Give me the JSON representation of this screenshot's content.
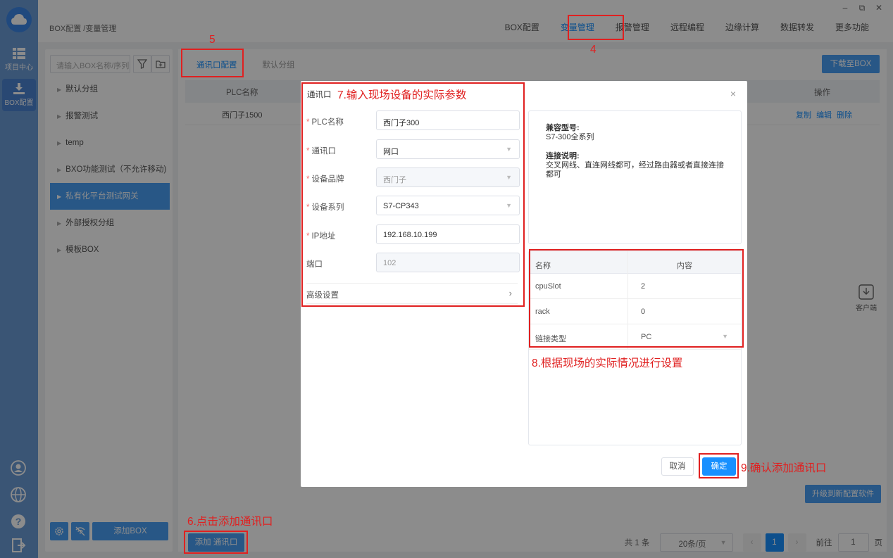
{
  "window": {
    "minimize": "–",
    "restore": "⧉",
    "close": "✕"
  },
  "rail": {
    "items": [
      {
        "label": "项目中心",
        "icon": "grid-icon"
      },
      {
        "label": "BOX配置",
        "icon": "download-icon"
      }
    ],
    "bottom_icons": [
      "user-icon",
      "globe-icon",
      "help-icon",
      "logout-icon"
    ]
  },
  "header": {
    "breadcrumb": "BOX配置 /变量管理",
    "nav": [
      "BOX配置",
      "变量管理",
      "报警管理",
      "远程编程",
      "边缘计算",
      "数据转发",
      "更多功能"
    ],
    "active_nav": "变量管理"
  },
  "sidebar": {
    "search_placeholder": "请输入BOX名称/序列号",
    "groups": [
      "默认分组",
      "报警测试",
      "temp",
      "BXO功能测试（不允许移动)",
      "私有化平台测试网关",
      "外部授权分组",
      "模板BOX"
    ],
    "active_group": "私有化平台测试网关",
    "add_box_label": "添加BOX"
  },
  "main": {
    "tabs": [
      "通讯口配置",
      "默认分组"
    ],
    "download_label": "下载至BOX",
    "table": {
      "col_plc": "PLC名称",
      "col_ops": "操作",
      "rows": [
        {
          "plc": "西门子1500",
          "ops": [
            "复制",
            "编辑",
            "删除"
          ]
        }
      ]
    },
    "upgrade_label": "升级到新配置软件",
    "add_port_label": "添加 通讯口",
    "pager": {
      "total": "共 1 条",
      "page_size": "20条/页",
      "current_page": "1",
      "goto_label": "前往",
      "goto_value": "1",
      "page_unit": "页"
    }
  },
  "client": {
    "label": "客户端"
  },
  "dialog": {
    "title": "通讯口",
    "fields": [
      {
        "label": "PLC名称",
        "required": true,
        "value": "西门子300",
        "type": "input"
      },
      {
        "label": "通讯口",
        "required": true,
        "value": "网口",
        "type": "select"
      },
      {
        "label": "设备品牌",
        "required": true,
        "value": "西门子",
        "type": "select-disabled"
      },
      {
        "label": "设备系列",
        "required": true,
        "value": "S7-CP343",
        "type": "select"
      },
      {
        "label": "IP地址",
        "required": true,
        "value": "192.168.10.199",
        "type": "input"
      },
      {
        "label": "端口",
        "required": false,
        "value": "102",
        "type": "input-disabled"
      }
    ],
    "advanced_label": "高级设置",
    "info": {
      "compat_title": "兼容型号:",
      "compat_value": "S7-300全系列",
      "conn_title": "连接说明:",
      "conn_value": "交叉网线、直连网线都可，经过路由器或者直接连接都可"
    },
    "params": {
      "col_name": "名称",
      "col_value": "内容",
      "rows": [
        {
          "name": "cpuSlot",
          "value": "2"
        },
        {
          "name": "rack",
          "value": "0"
        },
        {
          "name": "链接类型",
          "value": "PC"
        }
      ]
    },
    "cancel_label": "取消",
    "ok_label": "确定"
  },
  "annotations": {
    "a4": "4",
    "a5": "5",
    "a6": "6.点击添加通讯口",
    "a7": "7.输入现场设备的实际参数",
    "a8": "8.根据现场的实际情况进行设置",
    "a9": "9.确认添加通讯口"
  }
}
